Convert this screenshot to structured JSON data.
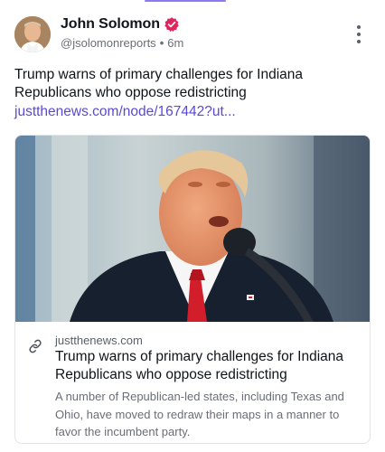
{
  "author": {
    "display_name": "John Solomon",
    "handle": "@jsolomonreports",
    "time_ago": "6m",
    "verified": true
  },
  "post": {
    "text": "Trump warns of primary challenges for Indiana Republicans who oppose redistricting",
    "link": "justthenews.com/node/167442?ut..."
  },
  "link_card": {
    "domain": "justthenews.com",
    "title": "Trump warns of primary challenges for Indiana Republicans who oppose redistricting",
    "description": "A number of Republican-led states, including Texas and Ohio, have moved to redraw their maps in a manner to favor the incumbent party."
  },
  "colors": {
    "link": "#5a49d6",
    "verified_badge": "#e0245e",
    "muted_text": "#6b6e76"
  },
  "icons": {
    "verified": "verified-badge-icon",
    "more": "more-vertical-icon",
    "link": "link-chain-icon"
  }
}
